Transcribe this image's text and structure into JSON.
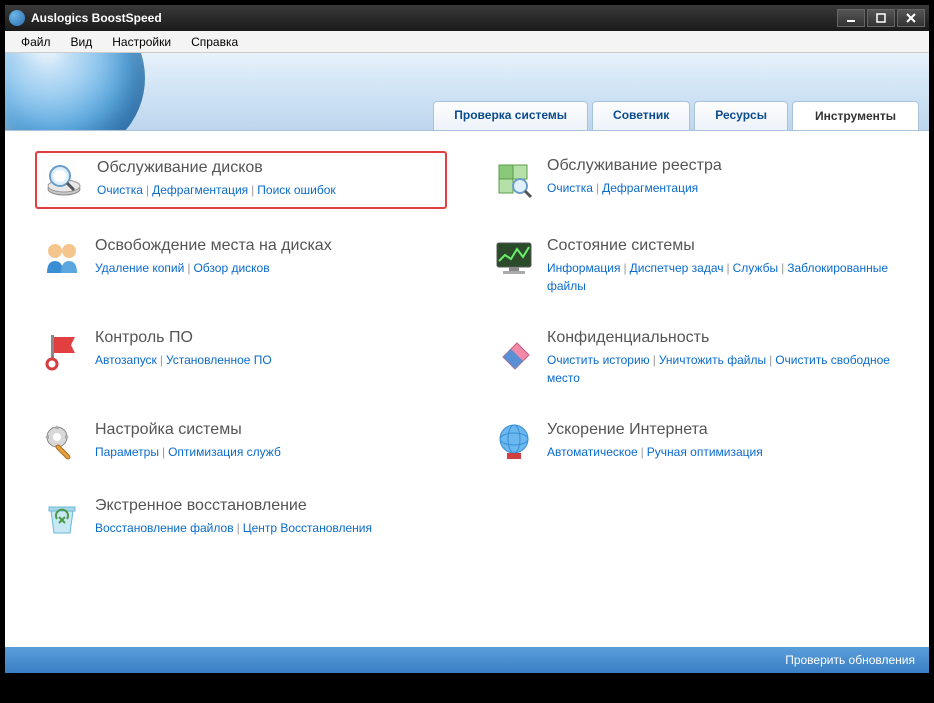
{
  "window": {
    "title": "Auslogics BoostSpeed"
  },
  "menu": {
    "file": "Файл",
    "view": "Вид",
    "settings": "Настройки",
    "help": "Справка"
  },
  "tabs": {
    "system_check": "Проверка системы",
    "advisor": "Советник",
    "resources": "Ресурсы",
    "tools": "Инструменты"
  },
  "tools": {
    "disk_maintenance": {
      "title": "Обслуживание дисков",
      "links": {
        "cleanup": "Очистка",
        "defrag": "Дефрагментация",
        "errors": "Поиск ошибок"
      }
    },
    "registry_maintenance": {
      "title": "Обслуживание реестра",
      "links": {
        "cleanup": "Очистка",
        "defrag": "Дефрагментация"
      }
    },
    "free_space": {
      "title": "Освобождение места на дисках",
      "links": {
        "dup": "Удаление копий",
        "overview": "Обзор дисков"
      }
    },
    "system_status": {
      "title": "Состояние системы",
      "links": {
        "info": "Информация",
        "tasks": "Диспетчер задач",
        "services": "Службы",
        "locked": "Заблокированные файлы"
      }
    },
    "software_control": {
      "title": "Контроль ПО",
      "links": {
        "autorun": "Автозапуск",
        "installed": "Установленное ПО"
      }
    },
    "privacy": {
      "title": "Конфиденциальность",
      "links": {
        "history": "Очистить историю",
        "shred": "Уничтожить файлы",
        "wipe": "Очистить свободное место"
      }
    },
    "system_tuning": {
      "title": "Настройка системы",
      "links": {
        "params": "Параметры",
        "services": "Оптимизация служб"
      }
    },
    "internet": {
      "title": "Ускорение Интернета",
      "links": {
        "auto": "Автоматическое",
        "manual": "Ручная оптимизация"
      }
    },
    "rescue": {
      "title": "Экстренное восстановление",
      "links": {
        "files": "Восстановление файлов",
        "center": "Центр Восстановления"
      }
    }
  },
  "status": {
    "check_updates": "Проверить обновления"
  }
}
